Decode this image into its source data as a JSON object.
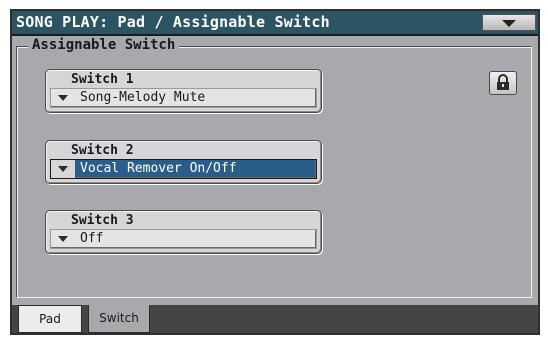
{
  "title": "SONG PLAY:  Pad / Assignable Switch",
  "group_title": "Assignable Switch",
  "switches": [
    {
      "label": "Switch 1",
      "value": "Song-Melody Mute",
      "selected": false
    },
    {
      "label": "Switch 2",
      "value": "Vocal Remover On/Off",
      "selected": true
    },
    {
      "label": "Switch 3",
      "value": "Off",
      "selected": false
    }
  ],
  "tabs": [
    {
      "label": "Pad",
      "active": false
    },
    {
      "label": "Switch",
      "active": true
    }
  ],
  "icons": {
    "menu": "chevron-down-icon",
    "lock": "lock-icon",
    "dropdown": "triangle-down-icon"
  },
  "colors": {
    "title_bar": "#2b5563",
    "panel_bg": "#a9a9ad",
    "selection": "#2a5e8a"
  }
}
